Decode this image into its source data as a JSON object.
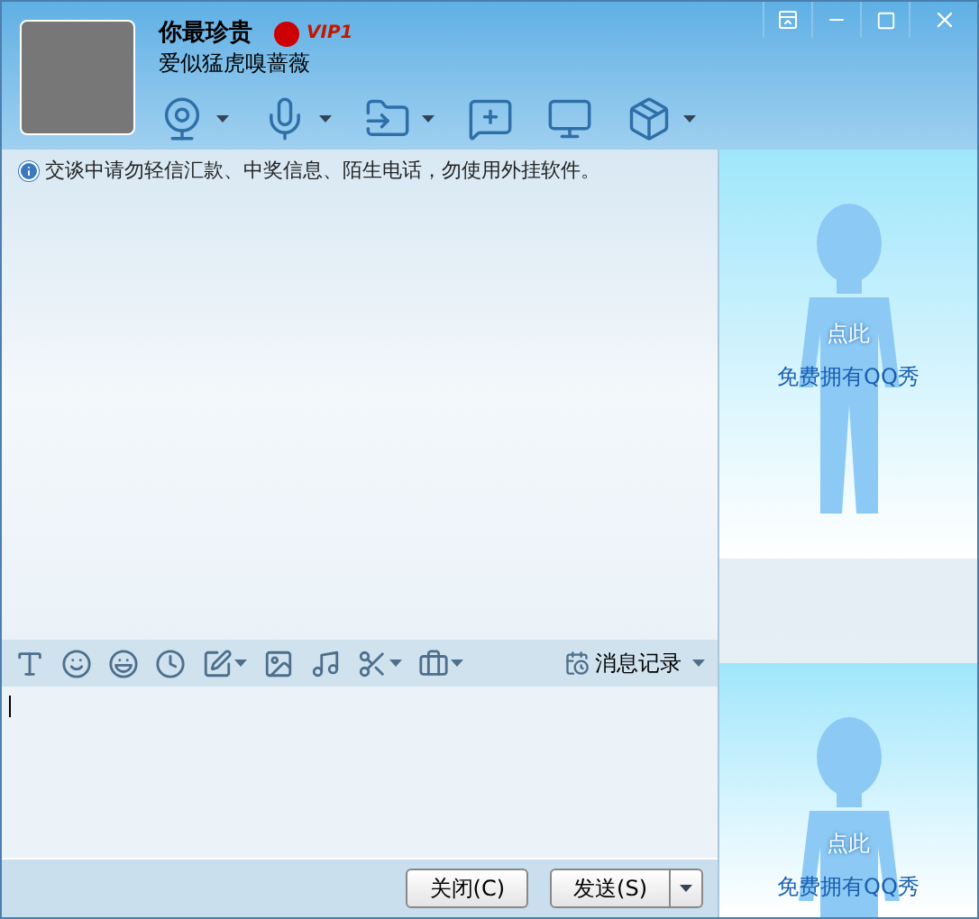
{
  "contact": {
    "name": "你最珍贵",
    "badge": "VIP1",
    "signature": "爱似猛虎嗅蔷薇"
  },
  "toolbar": [
    {
      "kind": "camera",
      "has_menu": true
    },
    {
      "kind": "mic",
      "has_menu": true
    },
    {
      "kind": "file",
      "has_menu": true
    },
    {
      "kind": "message",
      "has_menu": false
    },
    {
      "kind": "screen",
      "has_menu": false
    },
    {
      "kind": "box",
      "has_menu": true
    }
  ],
  "notice": "交谈中请勿轻信汇款、中奖信息、陌生电话，勿使用外挂软件。",
  "format_toolbar": [
    {
      "kind": "font",
      "has_menu": false
    },
    {
      "kind": "smile",
      "has_menu": false
    },
    {
      "kind": "hat",
      "has_menu": false
    },
    {
      "kind": "clock",
      "has_menu": false
    },
    {
      "kind": "pen",
      "has_menu": true
    },
    {
      "kind": "image",
      "has_menu": false
    },
    {
      "kind": "music",
      "has_menu": false
    },
    {
      "kind": "scissors",
      "has_menu": true
    },
    {
      "kind": "case",
      "has_menu": true
    }
  ],
  "history_button": "消息记录",
  "buttons": [
    {
      "label": "关闭(C)",
      "has_menu": false
    },
    {
      "label": "发送(S)",
      "has_menu": true
    }
  ],
  "show_panels": [
    {
      "line1": "点此",
      "line2": "免费拥有QQ秀"
    },
    {
      "line1": "点此",
      "line2": "免费拥有QQ秀"
    }
  ]
}
